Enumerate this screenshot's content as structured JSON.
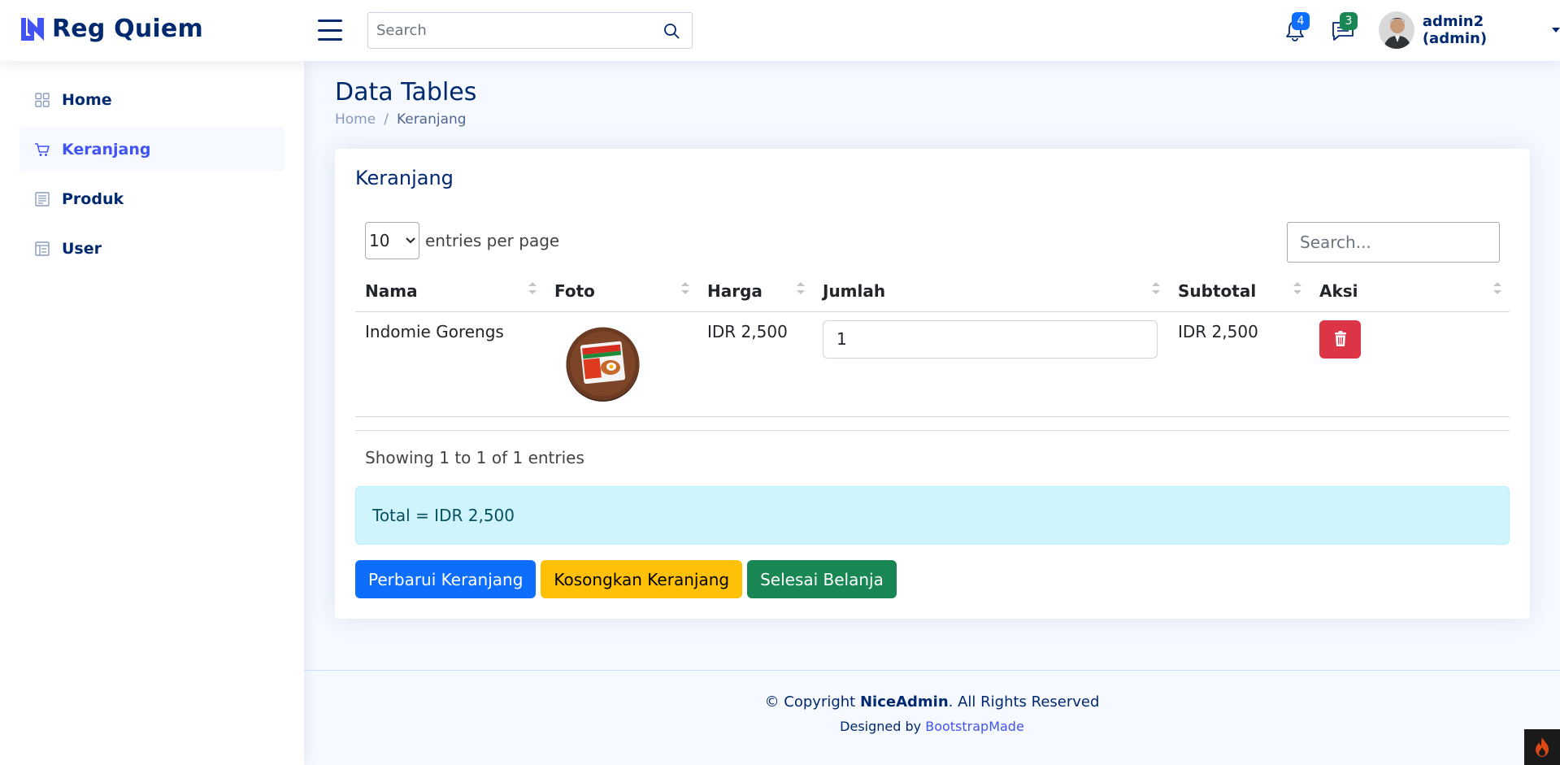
{
  "header": {
    "logo_text": "Reg Quiem",
    "search_placeholder": "Search",
    "notifications_count": "4",
    "messages_count": "3",
    "profile_name": "admin2 (admin)",
    "colors": {
      "notif_badge": "#0d6efd",
      "msg_badge": "#198754"
    }
  },
  "sidebar": {
    "items": [
      {
        "label": "Home",
        "icon": "grid-icon"
      },
      {
        "label": "Keranjang",
        "icon": "cart-icon"
      },
      {
        "label": "Produk",
        "icon": "layout-text-icon"
      },
      {
        "label": "User",
        "icon": "table-list-icon"
      }
    ]
  },
  "page": {
    "title": "Data Tables",
    "breadcrumb": [
      "Home",
      "Keranjang"
    ]
  },
  "card": {
    "title": "Keranjang",
    "entries_value": "10",
    "entries_label": "entries per page",
    "search_placeholder": "Search...",
    "columns": [
      "Nama",
      "Foto",
      "Harga",
      "Jumlah",
      "Subtotal",
      "Aksi"
    ],
    "rows": [
      {
        "nama": "Indomie Gorengs",
        "harga": "IDR 2,500",
        "jumlah": "1",
        "subtotal": "IDR 2,500"
      }
    ],
    "info": "Showing 1 to 1 of 1 entries",
    "total": "Total = IDR 2,500",
    "buttons": {
      "update": "Perbarui Keranjang",
      "empty": "Kosongkan Keranjang",
      "checkout": "Selesai Belanja"
    }
  },
  "footer": {
    "copyright_prefix": "© Copyright",
    "brand": "NiceAdmin",
    "rights": ". All Rights Reserved",
    "designed_by": "Designed by",
    "designer": "BootstrapMade"
  }
}
